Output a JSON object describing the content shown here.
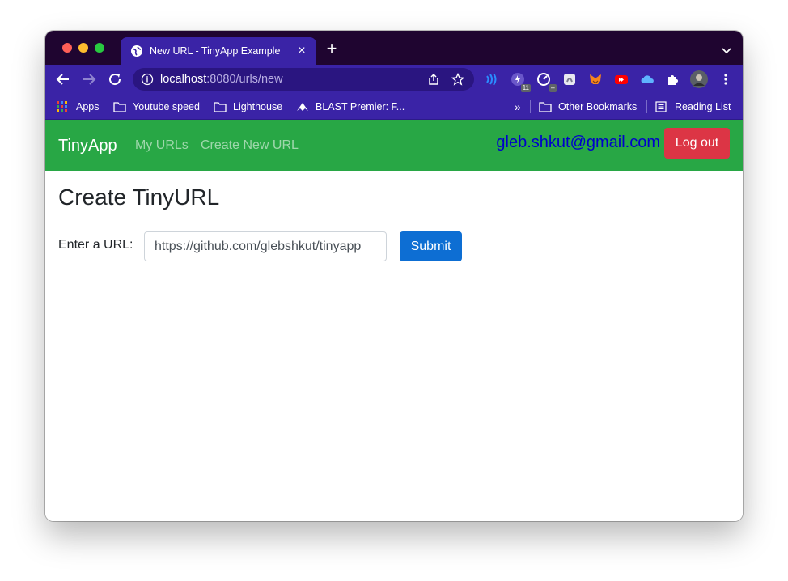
{
  "browser": {
    "tab_title": "New URL - TinyApp Example",
    "url_host": "localhost",
    "url_rest": ":8080/urls/new",
    "extension_badges": {
      "ext1": "11",
      "ext2": "--"
    },
    "bookmarks": {
      "apps": "Apps",
      "youtube_speed": "Youtube speed",
      "lighthouse": "Lighthouse",
      "blast": "BLAST Premier: F...",
      "other": "Other Bookmarks",
      "reading_list": "Reading List"
    }
  },
  "app": {
    "brand": "TinyApp",
    "nav": {
      "my_urls": "My URLs",
      "create_new": "Create New URL"
    },
    "user_email": "gleb.shkut@gmail.com",
    "logout_label": "Log out",
    "heading": "Create TinyURL",
    "form": {
      "label": "Enter a URL:",
      "value": "https://github.com/glebshkut/tinyapp",
      "submit_label": "Submit"
    }
  },
  "colors": {
    "navbar": "#28a745",
    "browser_chrome": "#3a23a6",
    "logout": "#dc3545",
    "submit": "#0d6ed3",
    "email": "#0000cc"
  },
  "icons": [
    "globe-icon",
    "close-icon",
    "plus-icon",
    "chevron-down-icon",
    "back-arrow-icon",
    "forward-arrow-icon",
    "reload-icon",
    "info-icon",
    "share-icon",
    "star-icon",
    "extension-icons",
    "puzzle-icon",
    "profile-avatar",
    "more-vert-icon",
    "apps-grid-icon",
    "folder-icon",
    "reading-list-icon"
  ]
}
